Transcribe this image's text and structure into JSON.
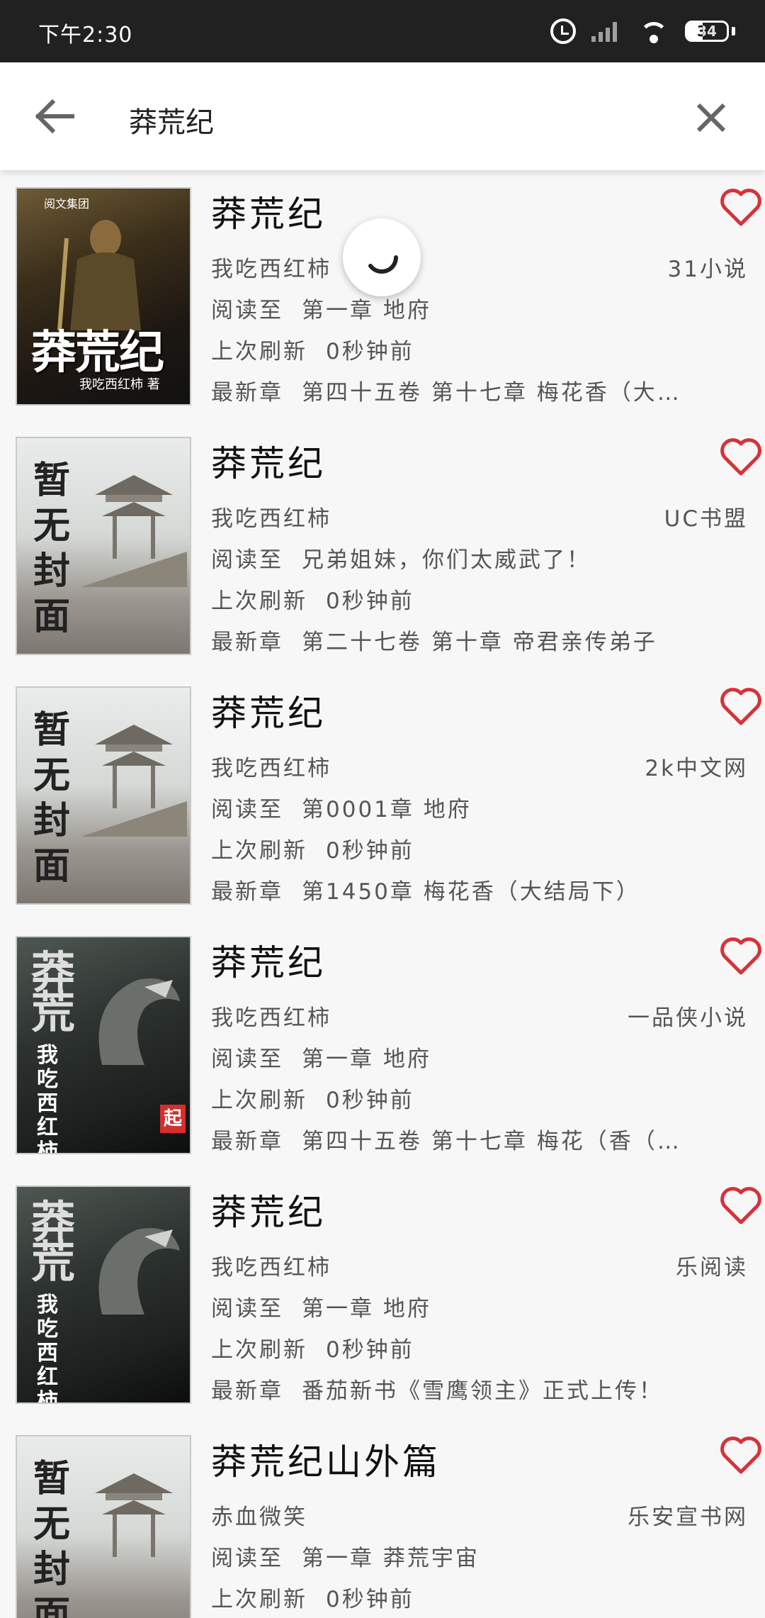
{
  "status_bar": {
    "time": "下午2:30",
    "battery": "34"
  },
  "header": {
    "search_text": "莽荒纪"
  },
  "labels": {
    "read_to": "阅读至",
    "last_refresh": "上次刷新",
    "latest": "最新章"
  },
  "results": [
    {
      "title": "莽荒纪",
      "author": "我吃西红柿",
      "source": "31小说",
      "read_to": "第一章 地府",
      "refreshed": "0秒钟前",
      "latest": "第四十五卷 第十七章 梅花香（大…",
      "cover": "qidian"
    },
    {
      "title": "莽荒纪",
      "author": "我吃西红柿",
      "source": "UC书盟",
      "read_to": "兄弟姐妹，你们太威武了！",
      "refreshed": "0秒钟前",
      "latest": "第二十七卷 第十章 帝君亲传弟子",
      "cover": "nocover"
    },
    {
      "title": "莽荒纪",
      "author": "我吃西红柿",
      "source": "2k中文网",
      "read_to": "第0001章 地府",
      "refreshed": "0秒钟前",
      "latest": "第1450章 梅花香（大结局下）",
      "cover": "nocover"
    },
    {
      "title": "莽荒纪",
      "author": "我吃西红柿",
      "source": "一品侠小说",
      "read_to": "第一章 地府",
      "refreshed": "0秒钟前",
      "latest": "第四十五卷 第十七章 梅花（香（…",
      "cover": "dark"
    },
    {
      "title": "莽荒纪",
      "author": "我吃西红柿",
      "source": "乐阅读",
      "read_to": "第一章 地府",
      "refreshed": "0秒钟前",
      "latest": "番茄新书《雪鹰领主》正式上传！",
      "cover": "dark"
    },
    {
      "title": "莽荒纪山外篇",
      "author": "赤血微笑",
      "source": "乐安宣书网",
      "read_to": "第一章 莽荒宇宙",
      "refreshed": "0秒钟前",
      "latest": "",
      "cover": "nocover"
    }
  ],
  "covers": {
    "qidian": {
      "publisher": "阅文集团",
      "title": "莽荒纪",
      "author": "我吃西红柿 著"
    },
    "nocover": {
      "title": "暂无封面"
    },
    "dark": {
      "title": "莽荒",
      "author": "我吃西红柿",
      "badge": "起"
    }
  },
  "colors": {
    "heart": "#d6323a",
    "statusbar": "#212121",
    "background": "#f7f7f7"
  }
}
